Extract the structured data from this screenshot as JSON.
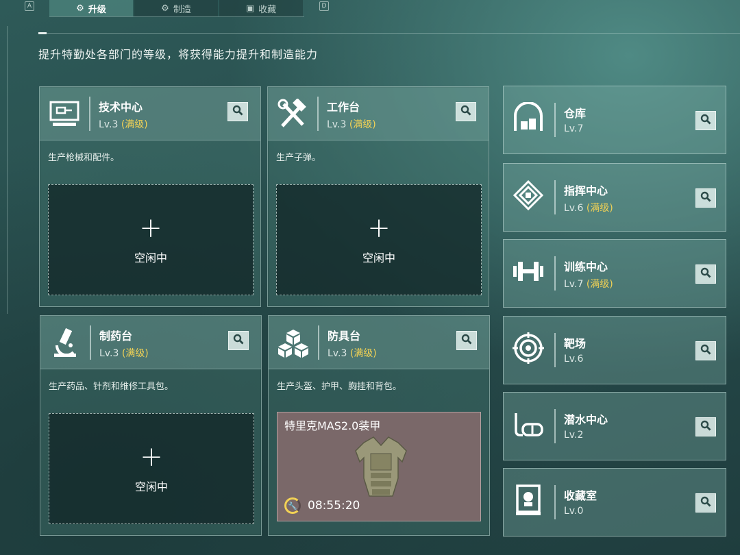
{
  "top_tabs": {
    "key_left": "A",
    "key_right": "D",
    "tabs": [
      {
        "label": "升级",
        "icon": "upgrade-icon",
        "active": true
      },
      {
        "label": "制造",
        "icon": "gears-icon",
        "active": false
      },
      {
        "label": "收藏",
        "icon": "collection-icon",
        "active": false
      }
    ]
  },
  "subtitle": "提升特勤处各部门的等级，将获得能力提升和制造能力",
  "cards": [
    {
      "name": "技术中心",
      "level": "Lv.3",
      "max_tag": "(满级)",
      "desc": "生产枪械和配件。",
      "icon": "computer-icon",
      "slot_plus": "+",
      "slot_status": "空闲中"
    },
    {
      "name": "工作台",
      "level": "Lv.3",
      "max_tag": "(满级)",
      "desc": "生产子弹。",
      "icon": "hammer-wrench-icon",
      "slot_plus": "+",
      "slot_status": "空闲中"
    },
    {
      "name": "制药台",
      "level": "Lv.3",
      "max_tag": "(满级)",
      "desc": "生产药品、针剂和维修工具包。",
      "icon": "microscope-icon",
      "slot_plus": "+",
      "slot_status": "空闲中"
    },
    {
      "name": "防具台",
      "level": "Lv.3",
      "max_tag": "(满级)",
      "desc": "生产头盔、护甲、胸挂和背包。",
      "icon": "cubes-icon",
      "crafting_item": "特里克MAS2.0装甲",
      "timer": "08:55:20",
      "progress": 0.7
    }
  ],
  "side_cards": [
    {
      "name": "仓库",
      "level": "Lv.7",
      "max_tag": "",
      "icon": "warehouse-icon"
    },
    {
      "name": "指挥中心",
      "level": "Lv.6",
      "max_tag": "(满级)",
      "icon": "command-chip-icon"
    },
    {
      "name": "训练中心",
      "level": "Lv.7",
      "max_tag": "(满级)",
      "icon": "dumbbell-icon"
    },
    {
      "name": "靶场",
      "level": "Lv.6",
      "max_tag": "",
      "icon": "target-icon"
    },
    {
      "name": "潜水中心",
      "level": "Lv.2",
      "max_tag": "",
      "icon": "diving-mask-icon"
    },
    {
      "name": "收藏室",
      "level": "Lv.0",
      "max_tag": "",
      "icon": "display-case-icon"
    }
  ],
  "colors": {
    "accent_maxed": "#f2d255",
    "background": "#284d4d",
    "busy_slot": "#7a6869"
  }
}
